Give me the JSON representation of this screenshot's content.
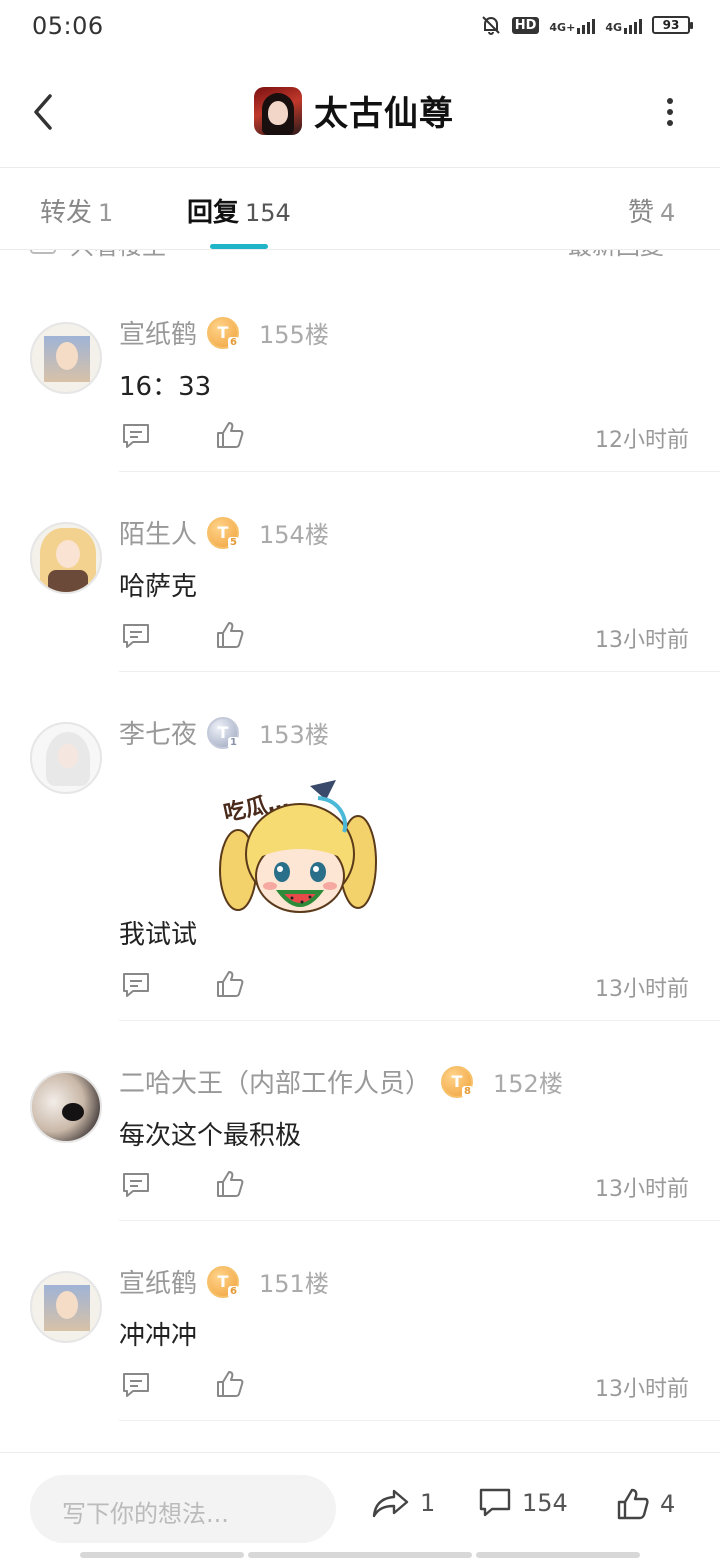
{
  "status_bar": {
    "time": "05:06",
    "battery": "93",
    "network1": "4G+",
    "network2": "4G",
    "hd": "HD"
  },
  "header": {
    "title": "太古仙尊"
  },
  "tabs": [
    {
      "label": "转发",
      "count": "1"
    },
    {
      "label": "回复",
      "count": "154"
    },
    {
      "label": "赞",
      "count": "4"
    }
  ],
  "filter": {
    "only_op": "只看楼主",
    "sort": "最新回复"
  },
  "replies": [
    {
      "name": "宣纸鹤",
      "level": "6",
      "floor": "155楼",
      "content": "16：33",
      "time": "12小时前"
    },
    {
      "name": "陌生人",
      "level": "5",
      "floor": "154楼",
      "content": "哈萨克",
      "time": "13小时前"
    },
    {
      "name": "李七夜",
      "level": "1",
      "floor": "153楼",
      "content": "我试试",
      "time": "13小时前"
    },
    {
      "name": "二哈大王（内部工作人员）",
      "level": "8",
      "floor": "152楼",
      "content": "每次这个最积极",
      "time": "13小时前"
    },
    {
      "name": "宣纸鹤",
      "level": "6",
      "floor": "151楼",
      "content": "冲冲冲",
      "time": "13小时前"
    }
  ],
  "sticker_text": "吃瓜…",
  "bottom_bar": {
    "placeholder": "写下你的想法...",
    "share_count": "1",
    "comment_count": "154",
    "like_count": "4"
  },
  "colors": {
    "accent": "#20b4c8"
  }
}
